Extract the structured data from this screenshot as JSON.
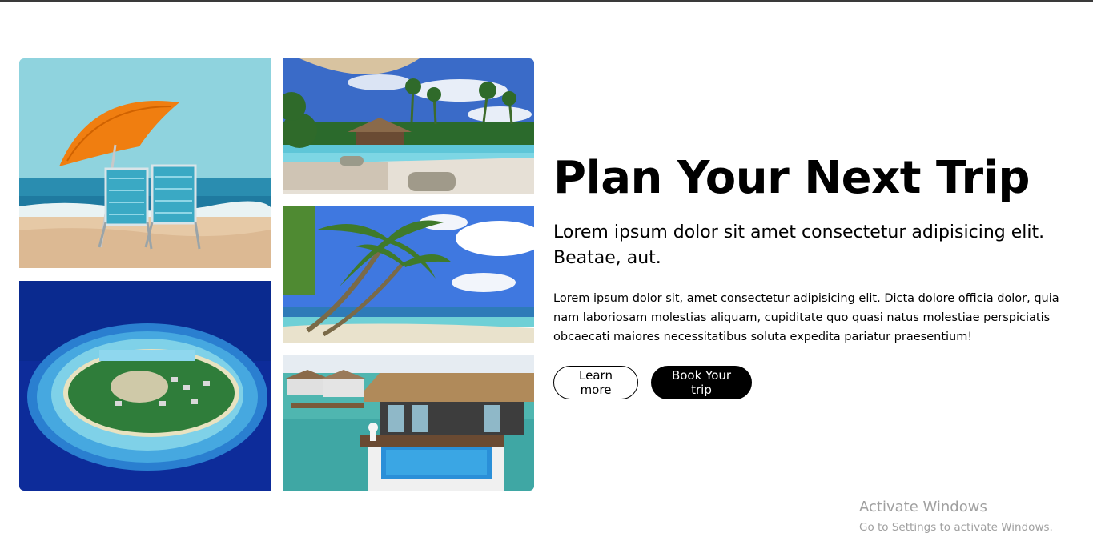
{
  "hero": {
    "title": "Plan Your Next Trip",
    "subtitle": "Lorem ipsum dolor sit amet consectetur adipisicing elit. Beatae, aut.",
    "body": "Lorem ipsum dolor sit, amet consectetur adipisicing elit. Dicta dolore officia dolor, quia nam laboriosam molestias aliquam, cupiditate quo quasi natus molestiae perspiciatis obcaecati maiores necessitatibus soluta expedita pariatur praesentium!",
    "learn_more_label": "Learn more",
    "book_label": "Book Your trip"
  },
  "gallery": {
    "images": [
      {
        "subject": "beach-umbrella-chairs"
      },
      {
        "subject": "tropical-island-aerial"
      },
      {
        "subject": "resort-pool"
      },
      {
        "subject": "palm-beach"
      },
      {
        "subject": "overwater-villa"
      }
    ]
  },
  "watermark": {
    "title": "Activate Windows",
    "subtitle": "Go to Settings to activate Windows."
  },
  "colors": {
    "top_bar": "#3a3a3a",
    "button_dark": "#000000",
    "watermark": "#a0a0a0"
  }
}
